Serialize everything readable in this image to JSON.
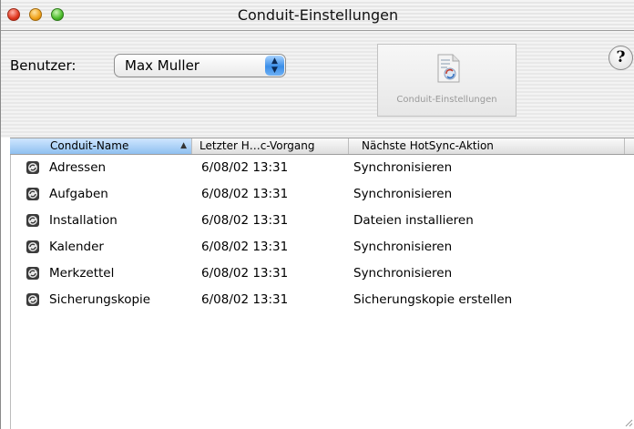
{
  "window": {
    "title": "Conduit-Einstellungen"
  },
  "toolbar": {
    "user_label": "Benutzer:",
    "user_value": "Max Muller",
    "conduit_button_label": "Conduit-Einstellungen",
    "help_label": "?"
  },
  "table": {
    "columns": [
      "Conduit-Name",
      "Letzter H…c-Vorgang",
      "Nächste HotSync-Aktion"
    ],
    "rows": [
      {
        "name": "Adressen",
        "last": "6/08/02 13:31",
        "next": "Synchronisieren"
      },
      {
        "name": "Aufgaben",
        "last": "6/08/02 13:31",
        "next": "Synchronisieren"
      },
      {
        "name": "Installation",
        "last": "6/08/02 13:31",
        "next": "Dateien installieren"
      },
      {
        "name": "Kalender",
        "last": "6/08/02 13:31",
        "next": "Synchronisieren"
      },
      {
        "name": "Merkzettel",
        "last": "6/08/02 13:31",
        "next": "Synchronisieren"
      },
      {
        "name": "Sicherungskopie",
        "last": "6/08/02 13:31",
        "next": "Sicherungskopie erstellen"
      }
    ]
  },
  "icons": {
    "row_icon": "hotsync-conduit-icon",
    "sort": "sort-ascending-icon",
    "popup": "popup-arrows-icon"
  }
}
